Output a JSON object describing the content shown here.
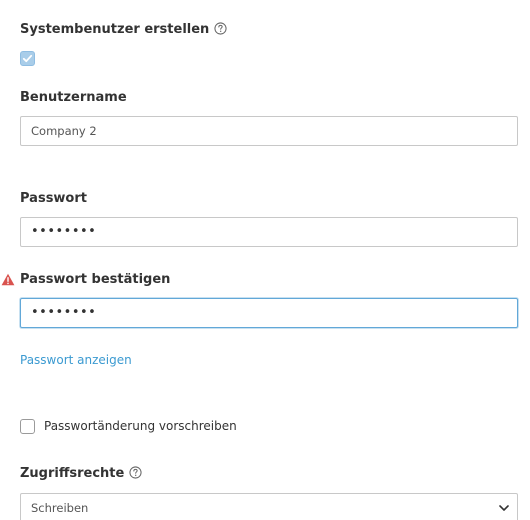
{
  "system_user": {
    "label": "Systembenutzer erstellen",
    "checked": true,
    "help_icon": "help-circle-icon"
  },
  "username": {
    "label": "Benutzername",
    "value": "Company 2"
  },
  "password": {
    "label": "Passwort",
    "masked_value": "••••••••"
  },
  "password_confirm": {
    "label": "Passwort bestätigen",
    "masked_value": "••••••••",
    "warning_icon": "warning-triangle-icon"
  },
  "show_password_link": "Passwort anzeigen",
  "require_password_change": {
    "label": "Passwortänderung vorschreiben",
    "checked": false
  },
  "access_rights": {
    "label": "Zugriffsrechte",
    "selected": "Schreiben",
    "help_icon": "help-circle-icon"
  },
  "colors": {
    "link": "#3b9ad1",
    "focus_border": "#62a8d8",
    "checkbox_checked": "#a9cde9",
    "warning": "#d9534f"
  }
}
